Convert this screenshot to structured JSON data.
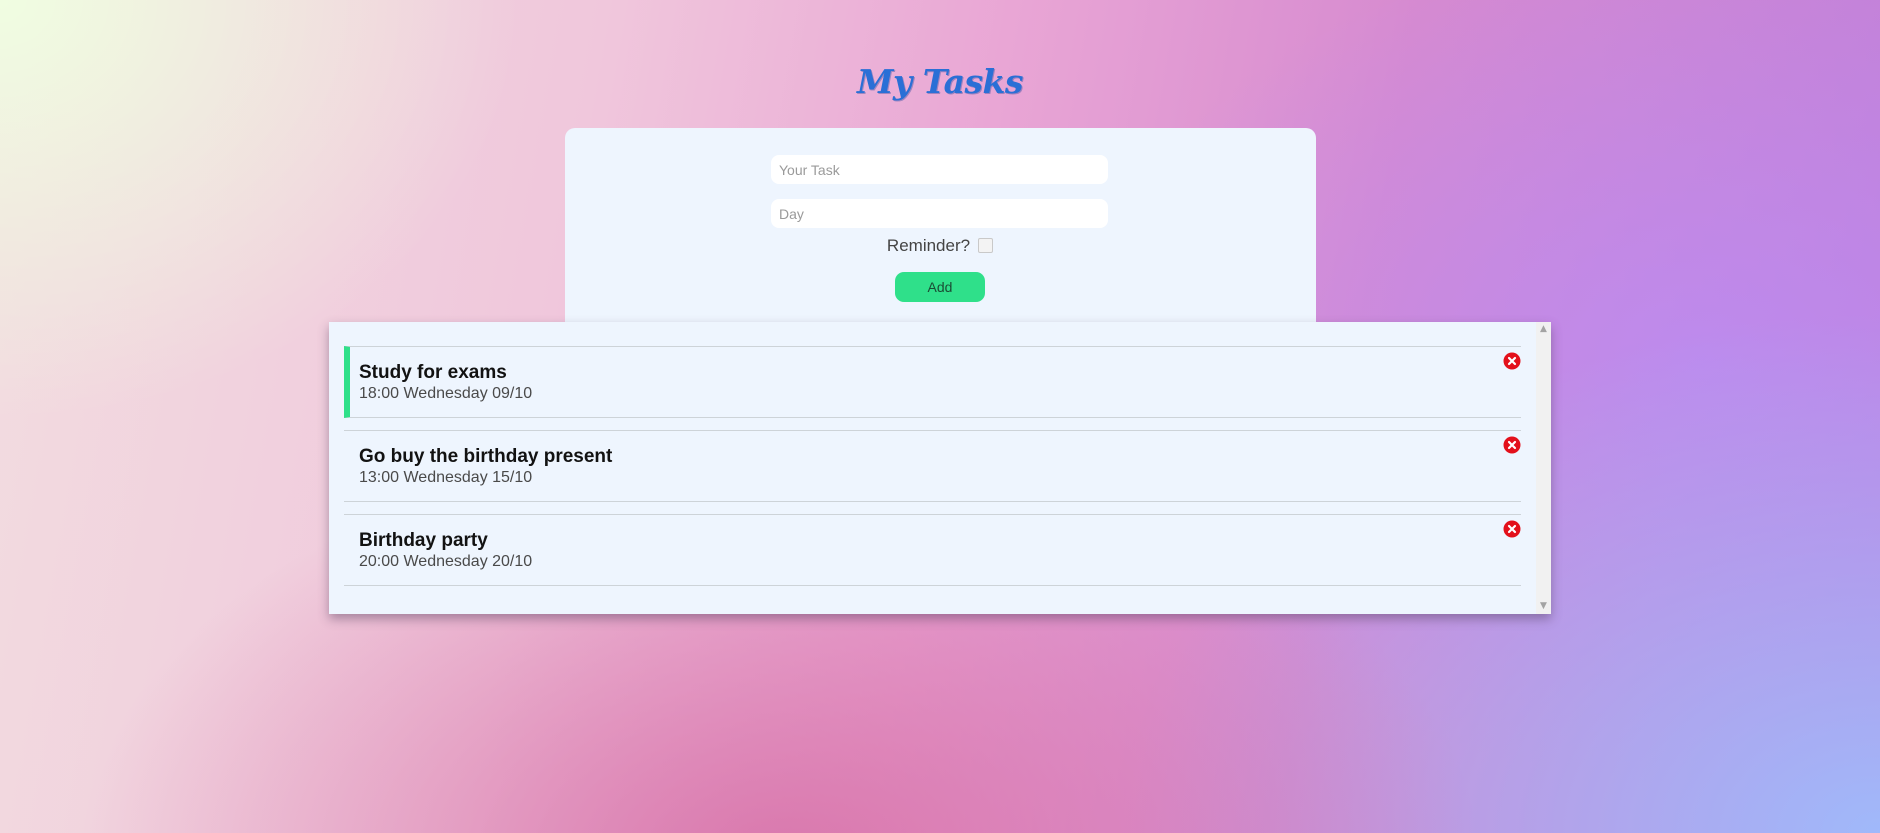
{
  "app": {
    "title": "My Tasks"
  },
  "form": {
    "task_placeholder": "Your Task",
    "task_value": "",
    "day_placeholder": "Day",
    "day_value": "",
    "reminder_label": "Reminder?",
    "reminder_checked": false,
    "add_label": "Add"
  },
  "tasks": [
    {
      "title": "Study for exams",
      "day": "18:00 Wednesday 09/10",
      "reminder": true
    },
    {
      "title": "Go buy the birthday present",
      "day": "13:00 Wednesday 15/10",
      "reminder": false
    },
    {
      "title": "Birthday party",
      "day": "20:00 Wednesday 20/10",
      "reminder": false
    }
  ],
  "icons": {
    "delete": "close-circle-icon",
    "scroll_up": "chevron-up-icon",
    "scroll_down": "chevron-down-icon"
  },
  "colors": {
    "title": "#2a6fd6",
    "accent": "#2fe08a",
    "delete": "#e3101b",
    "card_background": "#eef5fe"
  }
}
